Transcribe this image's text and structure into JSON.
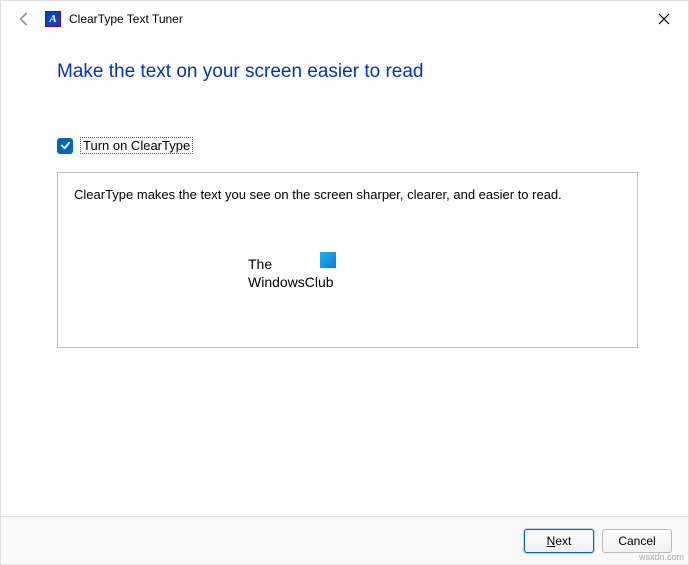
{
  "titlebar": {
    "app_title": "ClearType Text Tuner"
  },
  "content": {
    "heading": "Make the text on your screen easier to read",
    "checkbox_label": "Turn on ClearType",
    "checkbox_checked": true,
    "info_text": "ClearType makes the text you see on the screen sharper, clearer, and easier to read."
  },
  "watermark": {
    "line1": "The",
    "line2": "WindowsClub"
  },
  "footer": {
    "next_label": "Next",
    "cancel_label": "Cancel"
  },
  "attribution": "wsxdn.com"
}
